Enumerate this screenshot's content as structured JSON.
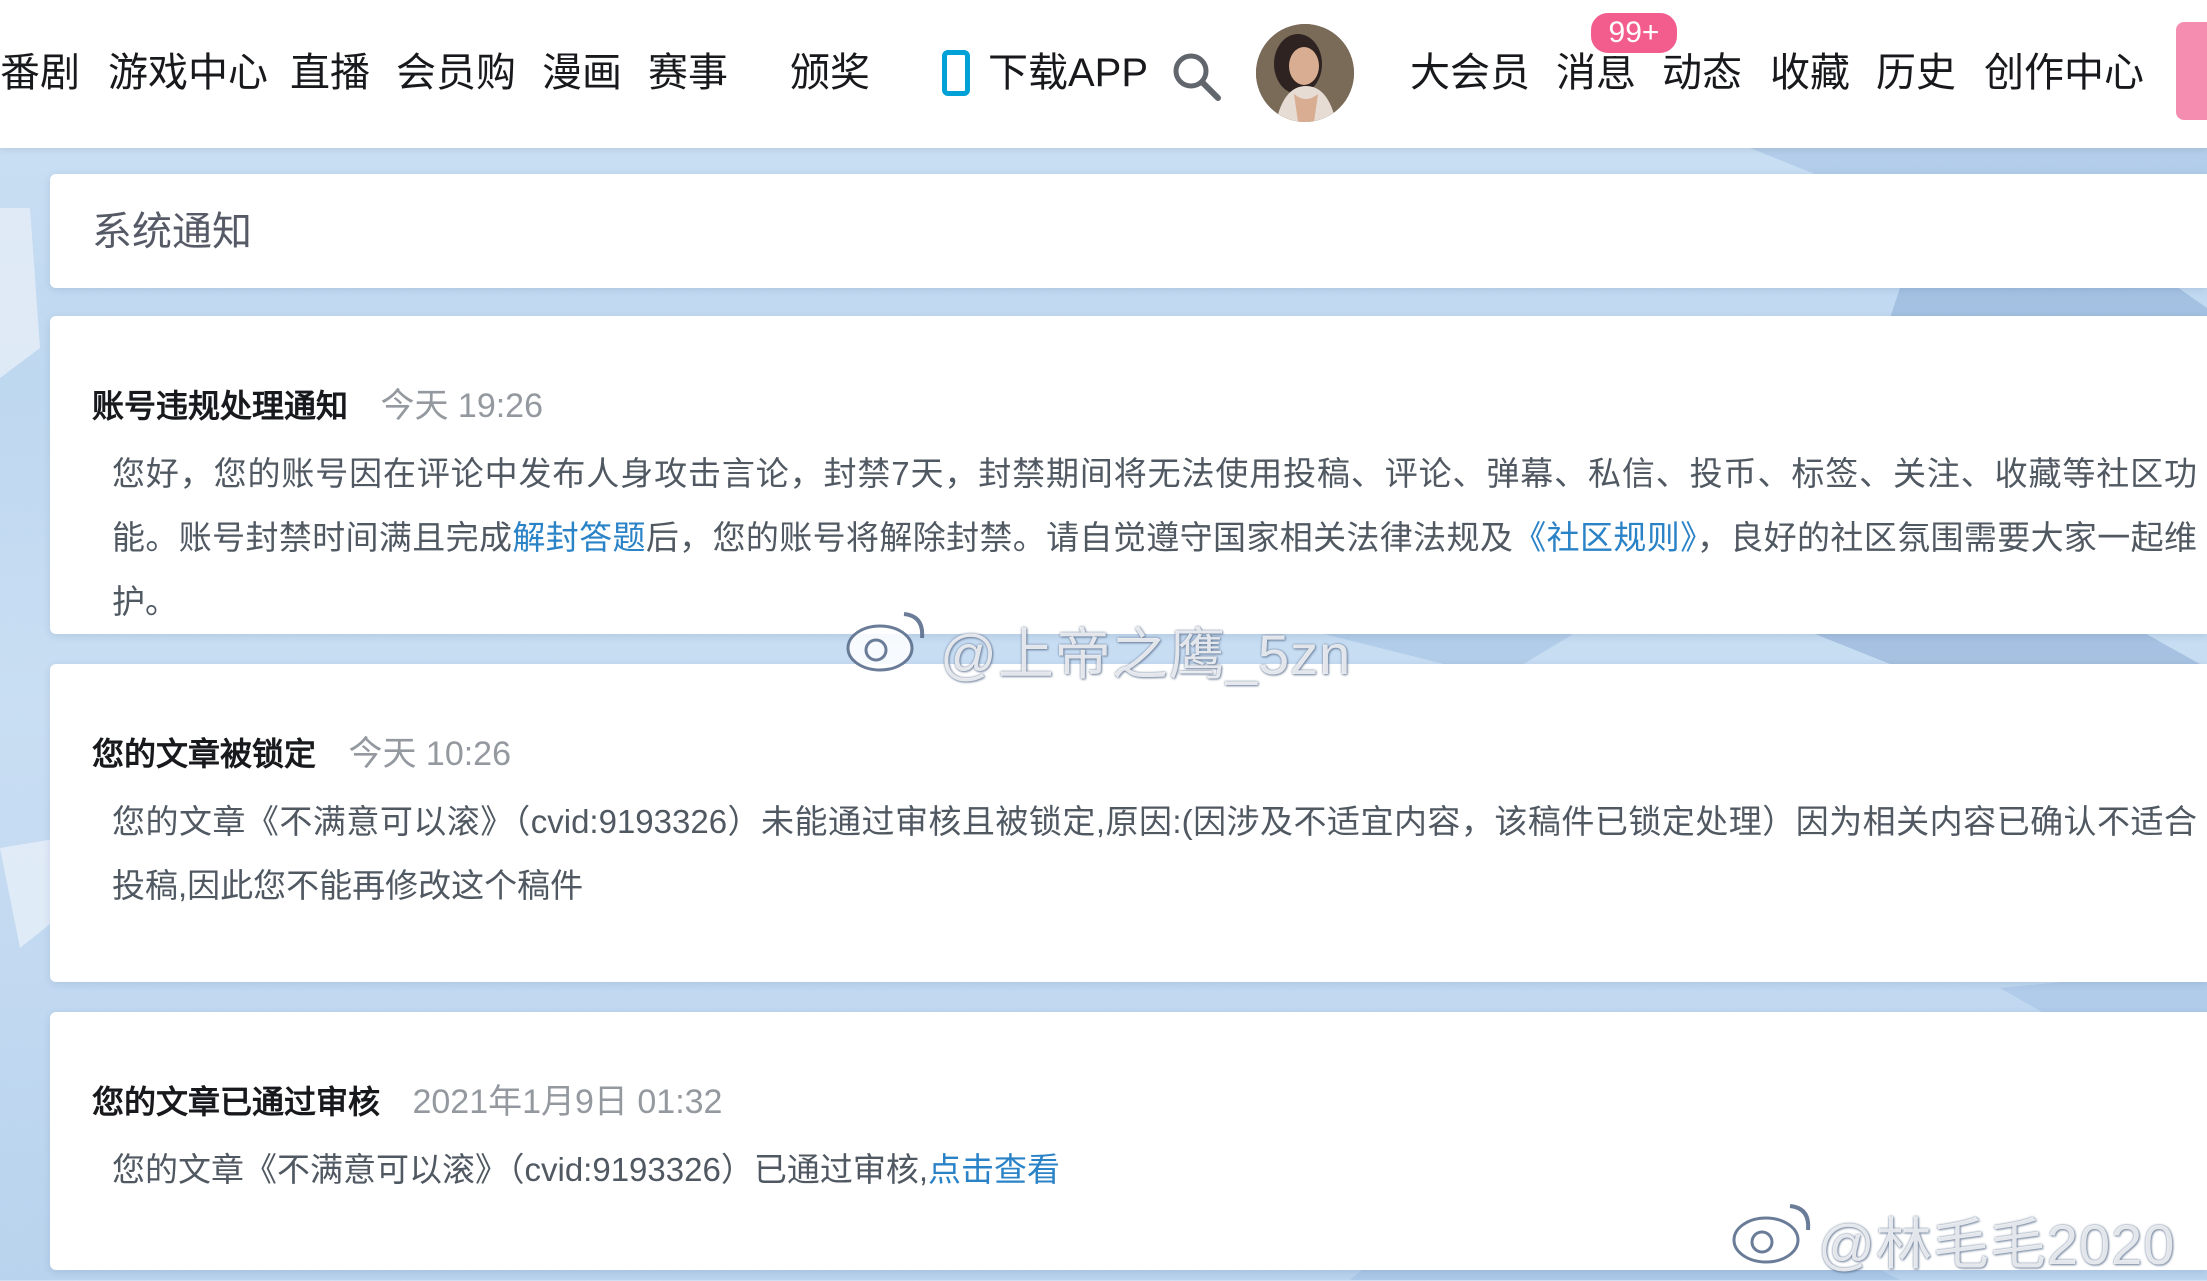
{
  "nav": {
    "items": [
      "番剧",
      "游戏中心",
      "直播",
      "会员购",
      "漫画",
      "赛事",
      "颁奖"
    ],
    "download": "下载APP",
    "right_items": [
      "大会员",
      "消息",
      "动态",
      "收藏",
      "历史",
      "创作中心"
    ],
    "badge": "99+",
    "colors": {
      "accent": "#00a1d6",
      "pink": "#f25d8e"
    }
  },
  "page": {
    "title": "系统通知"
  },
  "notices": [
    {
      "title": "账号违规处理通知",
      "time": "今天 19:26",
      "body_part1": "您好，您的账号因在评论中发布人身攻击言论，封禁7天，封禁期间将无法使用投稿、评论、弹幕、私信、投币、标签、关注、收藏等社区功能。账号封禁时间满且完成",
      "link1": "解封答题",
      "body_part2": "后，您的账号将解除封禁。请自觉遵守国家相关法律法规及",
      "link2": "《社区规则》",
      "body_part3": "，良好的社区氛围需要大家一起维护。"
    },
    {
      "title": "您的文章被锁定",
      "time": "今天 10:26",
      "body": "您的文章《不满意可以滚》（cvid:9193326）未能通过审核且被锁定,原因:(因涉及不适宜内容，该稿件已锁定处理）因为相关内容已确认不适合投稿,因此您不能再修改这个稿件"
    },
    {
      "title": "您的文章已通过审核",
      "time": "2021年1月9日 01:32",
      "body": "您的文章《不满意可以滚》（cvid:9193326）已通过审核,",
      "link": "点击查看"
    }
  ],
  "watermarks": [
    "@上帝之鹰_5zn",
    "@林毛毛2020"
  ]
}
